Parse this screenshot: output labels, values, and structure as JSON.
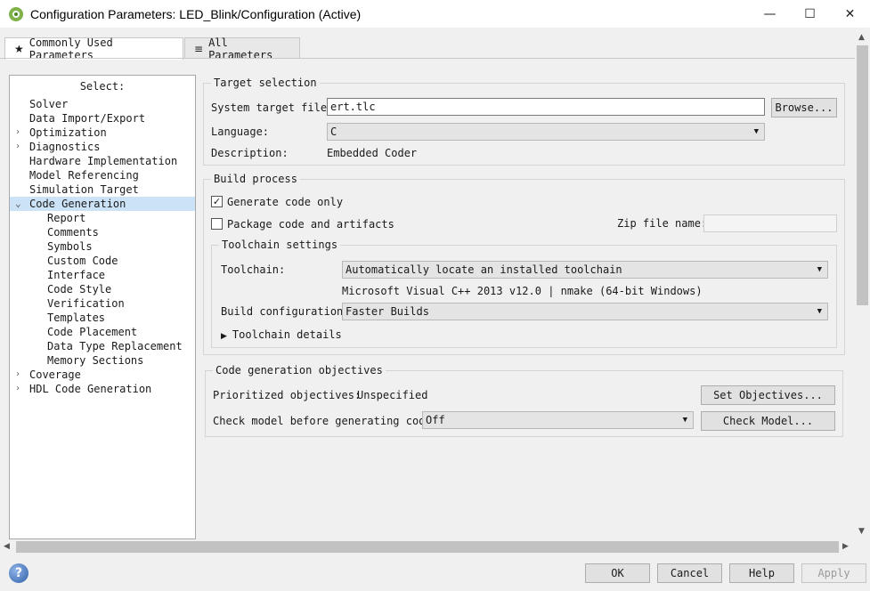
{
  "window": {
    "title": "Configuration Parameters: LED_Blink/Configuration (Active)",
    "minimize": "—",
    "maximize": "☐",
    "close": "✕"
  },
  "tabs": [
    {
      "label": "Commonly Used Parameters",
      "icon": "★"
    },
    {
      "label": "All Parameters",
      "icon": "≡"
    }
  ],
  "tree": {
    "title": "Select:",
    "items": [
      {
        "label": "Solver"
      },
      {
        "label": "Data Import/Export"
      },
      {
        "label": "Optimization"
      },
      {
        "label": "Diagnostics"
      },
      {
        "label": "Hardware Implementation"
      },
      {
        "label": "Model Referencing"
      },
      {
        "label": "Simulation Target"
      },
      {
        "label": "Code Generation"
      },
      {
        "label": "Report"
      },
      {
        "label": "Comments"
      },
      {
        "label": "Symbols"
      },
      {
        "label": "Custom Code"
      },
      {
        "label": "Interface"
      },
      {
        "label": "Code Style"
      },
      {
        "label": "Verification"
      },
      {
        "label": "Templates"
      },
      {
        "label": "Code Placement"
      },
      {
        "label": "Data Type Replacement"
      },
      {
        "label": "Memory Sections"
      },
      {
        "label": "Coverage"
      },
      {
        "label": "HDL Code Generation"
      }
    ]
  },
  "target_selection": {
    "title": "Target selection",
    "system_target_label": "System target file:",
    "system_target_value": "ert.tlc",
    "browse_label": "Browse...",
    "language_label": "Language:",
    "language_value": "C",
    "description_label": "Description:",
    "description_value": "Embedded Coder"
  },
  "build_process": {
    "title": "Build process",
    "generate_code_only": "Generate code only",
    "package_code": "Package code and artifacts",
    "zip_label": "Zip file name:",
    "zip_value": "",
    "toolchain_settings": {
      "title": "Toolchain settings",
      "toolchain_label": "Toolchain:",
      "toolchain_value": "Automatically locate an installed toolchain",
      "toolchain_info": "Microsoft Visual C++ 2013 v12.0 | nmake (64-bit Windows)",
      "build_config_label": "Build configuration:",
      "build_config_value": "Faster Builds",
      "details_label": "Toolchain details"
    }
  },
  "objectives": {
    "title": "Code generation objectives",
    "prioritized_label": "Prioritized objectives:",
    "prioritized_value": "Unspecified",
    "set_objectives_label": "Set Objectives...",
    "check_label": "Check model before generating code:",
    "check_value": "Off",
    "check_model_label": "Check Model..."
  },
  "buttons": {
    "ok": "OK",
    "cancel": "Cancel",
    "help": "Help",
    "apply": "Apply"
  }
}
